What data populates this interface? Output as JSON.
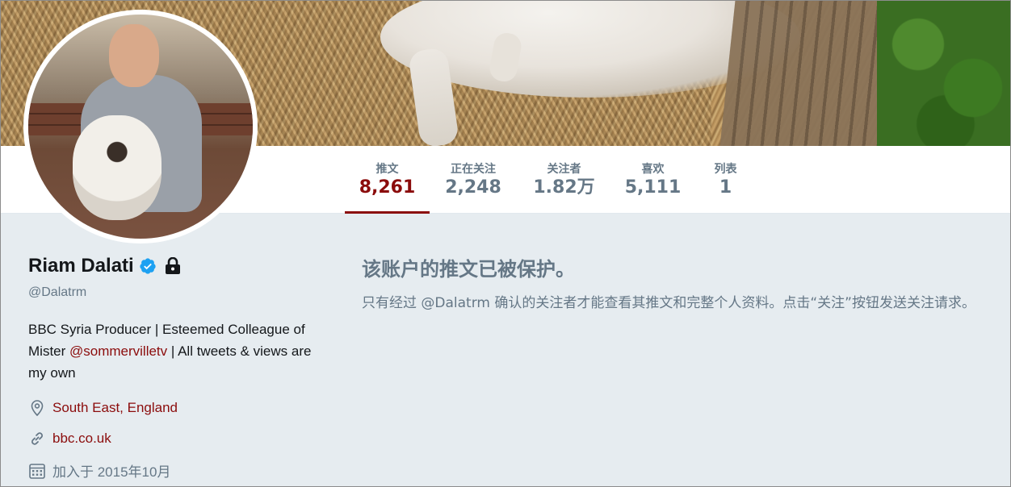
{
  "profile": {
    "name": "Riam Dalati",
    "handle": "@Dalatrm",
    "bio_part1": "BBC Syria Producer | Esteemed Colleague of Mister ",
    "bio_mention": "@sommervilletv",
    "bio_part2": " | All tweets & views are my own",
    "location": "South East, England",
    "website": "bbc.co.uk",
    "joined": "加入于 2015年10月"
  },
  "nav": {
    "items": [
      {
        "label": "推文",
        "value": "8,261",
        "active": true
      },
      {
        "label": "正在关注",
        "value": "2,248"
      },
      {
        "label": "关注者",
        "value": "1.82万"
      },
      {
        "label": "喜欢",
        "value": "5,111"
      },
      {
        "label": "列表",
        "value": "1"
      }
    ]
  },
  "protected": {
    "title": "该账户的推文已被保护。",
    "text": "只有经过 @Dalatrm 确认的关注者才能查看其推文和完整个人资料。点击“关注”按钮发送关注请求。"
  },
  "colors": {
    "accent": "#8b0c0c",
    "muted": "#657786",
    "background": "#e6ecf0",
    "verified": "#1da1f2"
  }
}
